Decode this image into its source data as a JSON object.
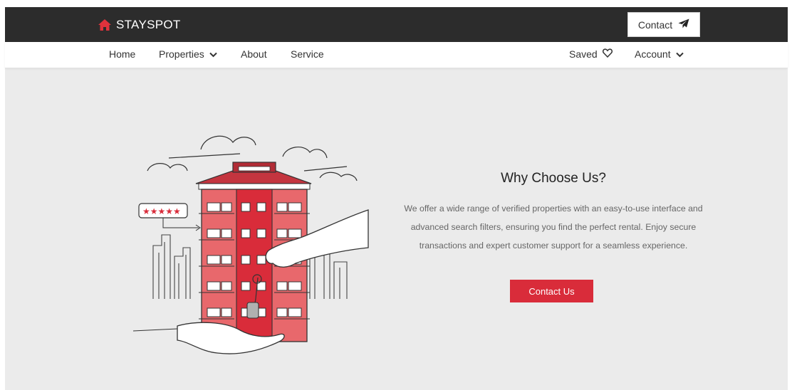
{
  "header": {
    "brand": "STAYSPOT",
    "contact_label": "Contact"
  },
  "nav": {
    "home": "Home",
    "properties": "Properties",
    "about": "About",
    "service": "Service",
    "saved": "Saved",
    "account": "Account"
  },
  "hero": {
    "heading": "Why Choose Us?",
    "description": "We offer a wide range of verified properties with an easy-to-use interface and advanced search filters, ensuring you find the perfect rental. Enjoy secure transactions and expert customer support for a seamless experience.",
    "cta_label": "Contact Us",
    "rating_stars": 5
  },
  "icons": {
    "brand": "home-icon",
    "contact": "paper-plane-icon",
    "dropdown": "chevron-down-icon",
    "saved": "heart-icon"
  },
  "colors": {
    "topbar": "#2c2c2c",
    "accent": "#d92c3a",
    "background": "#ebebeb",
    "building": "#e8686c"
  }
}
